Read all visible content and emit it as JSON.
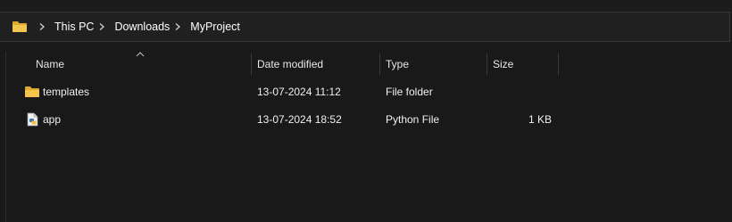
{
  "breadcrumb": {
    "root_icon": "folder-icon",
    "items": [
      "This PC",
      "Downloads",
      "MyProject"
    ],
    "separator_icon": "chevron-right-icon"
  },
  "columns": {
    "name": "Name",
    "date_modified": "Date modified",
    "type": "Type",
    "size": "Size",
    "sort_indicator": "chevron-up-icon"
  },
  "files": [
    {
      "name": "templates",
      "date_modified": "13-07-2024 11:12",
      "type": "File folder",
      "size": "",
      "icon": "folder-icon"
    },
    {
      "name": "app",
      "date_modified": "13-07-2024 18:52",
      "type": "Python File",
      "size": "1 KB",
      "icon": "python-file-icon"
    }
  ],
  "colors": {
    "background": "#191919",
    "folder_yellow": "#f0c14b",
    "text": "#ffffff"
  }
}
